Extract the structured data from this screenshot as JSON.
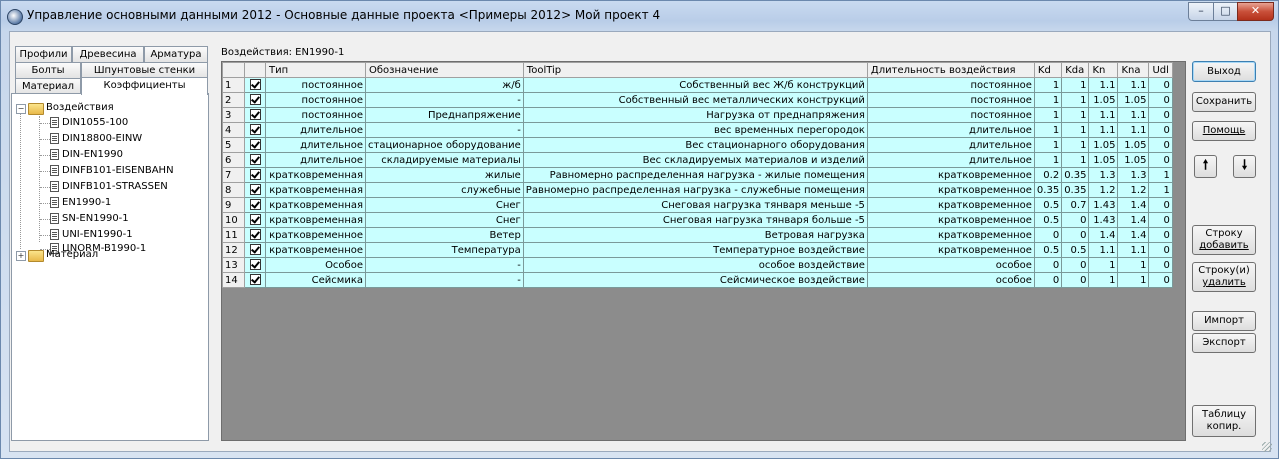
{
  "window": {
    "title": "Управление основными данными 2012 - Основные данные проекта <Примеры 2012> Мой проект 4",
    "min_glyph": "–",
    "max_glyph": "□",
    "close_glyph": "✕"
  },
  "tabs": {
    "row1": [
      "Профили",
      "Древесина",
      "Арматура"
    ],
    "row2": [
      "Болты",
      "Шпунтовые стенки"
    ],
    "row3": [
      "Материал",
      "Коэффициенты"
    ],
    "active": "Коэффициенты"
  },
  "tree": {
    "root": {
      "label": "Воздействия",
      "expander": "−"
    },
    "children": [
      "DIN1055-100",
      "DIN18800-EINW",
      "DIN-EN1990",
      "DINFB101-EISENBAHN",
      "DINFB101-STRASSEN",
      "EN1990-1",
      "SN-EN1990-1",
      "UNI-EN1990-1",
      "ЦNORM-B1990-1"
    ],
    "second": {
      "label": "Материал",
      "expander": "+"
    }
  },
  "grid": {
    "label": "Воздействия: EN1990-1",
    "columns": [
      "",
      "",
      "Тип",
      "Обозначение",
      "ToolTip",
      "Длительность воздействия",
      "Kd",
      "Kda",
      "Kn",
      "Kna",
      "Udl"
    ],
    "rows": [
      {
        "n": "1",
        "checked": true,
        "type": "постоянное",
        "name": "ж/б",
        "tip": "Собственный вес Ж/б конструкций",
        "dur": "постоянное",
        "kd": "1",
        "kda": "1",
        "kn": "1.1",
        "kna": "1.1",
        "udl": "0"
      },
      {
        "n": "2",
        "checked": true,
        "type": "постоянное",
        "name": "-",
        "tip": "Собственный вес металлических конструкций",
        "dur": "постоянное",
        "kd": "1",
        "kda": "1",
        "kn": "1.05",
        "kna": "1.05",
        "udl": "0"
      },
      {
        "n": "3",
        "checked": true,
        "type": "постоянное",
        "name": "Преднапряжение",
        "tip": "Нагрузка от преднапряжения",
        "dur": "постоянное",
        "kd": "1",
        "kda": "1",
        "kn": "1.1",
        "kna": "1.1",
        "udl": "0"
      },
      {
        "n": "4",
        "checked": true,
        "type": "длительное",
        "name": "-",
        "tip": "вес временных перегородок",
        "dur": "длительное",
        "kd": "1",
        "kda": "1",
        "kn": "1.1",
        "kna": "1.1",
        "udl": "0"
      },
      {
        "n": "5",
        "checked": true,
        "type": "длительное",
        "name": "стационарное оборудование",
        "tip": "Вес стационарного оборудования",
        "dur": "длительное",
        "kd": "1",
        "kda": "1",
        "kn": "1.05",
        "kna": "1.05",
        "udl": "0"
      },
      {
        "n": "6",
        "checked": true,
        "type": "длительное",
        "name": "складируемые материалы",
        "tip": "Вес складируемых материалов и изделий",
        "dur": "длительное",
        "kd": "1",
        "kda": "1",
        "kn": "1.05",
        "kna": "1.05",
        "udl": "0"
      },
      {
        "n": "7",
        "checked": true,
        "type": "кратковременная",
        "name": "жилые",
        "tip": "Равномерно распределенная нагрузка - жилые помещения",
        "dur": "кратковременное",
        "kd": "0.2",
        "kda": "0.35",
        "kn": "1.3",
        "kna": "1.3",
        "udl": "1"
      },
      {
        "n": "8",
        "checked": true,
        "type": "кратковременная",
        "name": "служебные",
        "tip": "Равномерно распределенная нагрузка - служебные помещения",
        "dur": "кратковременное",
        "kd": "0.35",
        "kda": "0.35",
        "kn": "1.2",
        "kna": "1.2",
        "udl": "1"
      },
      {
        "n": "9",
        "checked": true,
        "type": "кратковременная",
        "name": "Снег",
        "tip": "Снеговая нагрузка тянваря меньше -5",
        "dur": "кратковременное",
        "kd": "0.5",
        "kda": "0.7",
        "kn": "1.43",
        "kna": "1.4",
        "udl": "0"
      },
      {
        "n": "10",
        "checked": true,
        "type": "кратковременная",
        "name": "Снег",
        "tip": "Снеговая нагрузка тянваря больше -5",
        "dur": "кратковременное",
        "kd": "0.5",
        "kda": "0",
        "kn": "1.43",
        "kna": "1.4",
        "udl": "0"
      },
      {
        "n": "11",
        "checked": true,
        "type": "кратковременное",
        "name": "Ветер",
        "tip": "Ветровая нагрузка",
        "dur": "кратковременное",
        "kd": "0",
        "kda": "0",
        "kn": "1.4",
        "kna": "1.4",
        "udl": "0"
      },
      {
        "n": "12",
        "checked": true,
        "type": "кратковременное",
        "name": "Температура",
        "tip": "Температурное воздействие",
        "dur": "кратковременное",
        "kd": "0.5",
        "kda": "0.5",
        "kn": "1.1",
        "kna": "1.1",
        "udl": "0"
      },
      {
        "n": "13",
        "checked": true,
        "type": "Особое",
        "name": "-",
        "tip": "особое воздействие",
        "dur": "особое",
        "kd": "0",
        "kda": "0",
        "kn": "1",
        "kna": "1",
        "udl": "0"
      },
      {
        "n": "14",
        "checked": true,
        "type": "Сейсмика",
        "name": "-",
        "tip": "Сейсмическое воздействие",
        "dur": "особое",
        "kd": "0",
        "kda": "0",
        "kn": "1",
        "kna": "1",
        "udl": "0"
      }
    ]
  },
  "buttons": {
    "exit": "Выход",
    "save": "Сохранить",
    "help": "Помощь",
    "up": "🠕",
    "down": "🠗",
    "add_row_1": "Строку",
    "add_row_2": "добавить",
    "del_row_1": "Строку(и)",
    "del_row_2": "удалить",
    "import": "Импорт",
    "export": "Экспорт",
    "copy_1": "Таблицу",
    "copy_2": "копир."
  }
}
